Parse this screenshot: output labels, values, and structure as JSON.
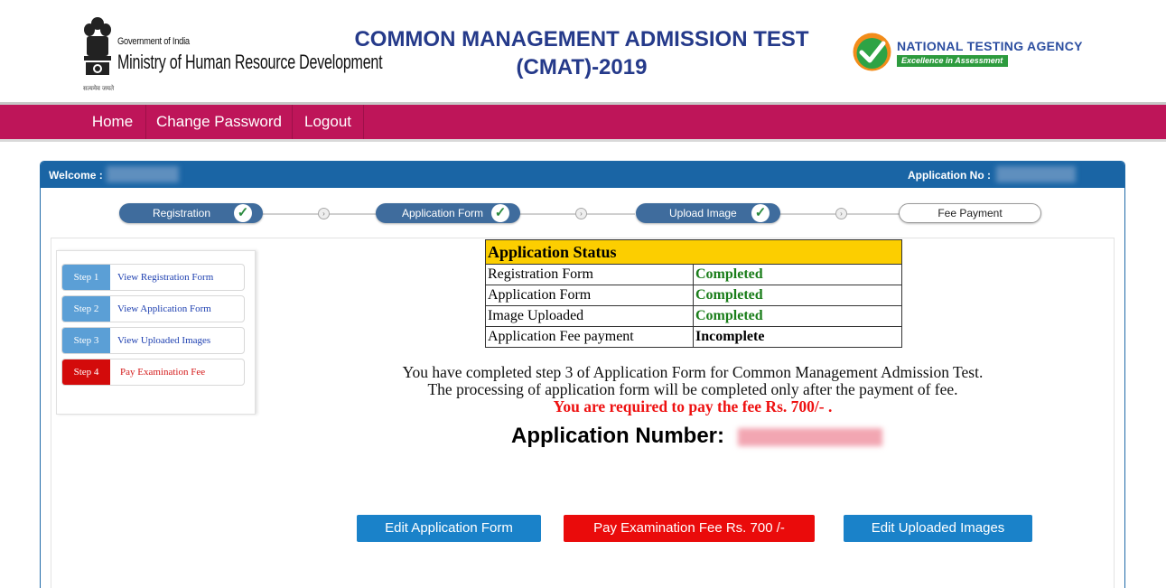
{
  "header": {
    "gov_small": "Government of India",
    "gov_big": "Ministry of Human Resource Development",
    "emblem_caption": "सत्यमेव जयते",
    "title_line1": "COMMON MANAGEMENT ADMISSION TEST",
    "title_line2": "(CMAT)-2019",
    "nta_name": "NATIONAL TESTING AGENCY",
    "nta_tagline": "Excellence in Assessment"
  },
  "nav": {
    "items": [
      {
        "label": "Home"
      },
      {
        "label": "Change Password"
      },
      {
        "label": "Logout"
      }
    ]
  },
  "panel": {
    "welcome_label": "Welcome :",
    "application_no_label": "Application No :"
  },
  "progress": {
    "steps": [
      {
        "label": "Registration",
        "done": true
      },
      {
        "label": "Application Form",
        "done": true
      },
      {
        "label": "Upload Image",
        "done": true
      },
      {
        "label": "Fee Payment",
        "done": false
      }
    ],
    "check_glyph": "✓",
    "arrow_glyph": "›"
  },
  "side_menu": {
    "items": [
      {
        "step": "Step 1",
        "label": "View Registration Form"
      },
      {
        "step": "Step 2",
        "label": "View Application Form"
      },
      {
        "step": "Step 3",
        "label": "View Uploaded Images"
      },
      {
        "step": "Step 4",
        "label": "Pay Examination Fee"
      }
    ]
  },
  "status": {
    "title": "Application Status",
    "rows": [
      {
        "label": "Registration Form",
        "value": "Completed"
      },
      {
        "label": "Application Form",
        "value": "Completed"
      },
      {
        "label": "Image Uploaded",
        "value": "Completed"
      },
      {
        "label": "Application Fee payment",
        "value": "Incomplete"
      }
    ]
  },
  "message": {
    "line1": "You have completed step 3 of Application Form for Common Management Admission Test.",
    "line2": "The processing of application form will be completed only after the payment of fee.",
    "line3": "You are required to pay the fee Rs. 700/- ."
  },
  "application_number_label": "Application Number:",
  "buttons": {
    "edit_form": "Edit Application Form",
    "pay_fee": "Pay Examination Fee Rs. 700 /-",
    "edit_images": "Edit Uploaded Images"
  },
  "colors": {
    "nav_bg": "#be1559",
    "panel_head": "#1a65a5",
    "title_blue": "#253a8a",
    "status_header": "#fcce00",
    "completed_green": "#1a7d1a",
    "pay_red": "#ea0b0b",
    "button_blue": "#1a82c9"
  }
}
